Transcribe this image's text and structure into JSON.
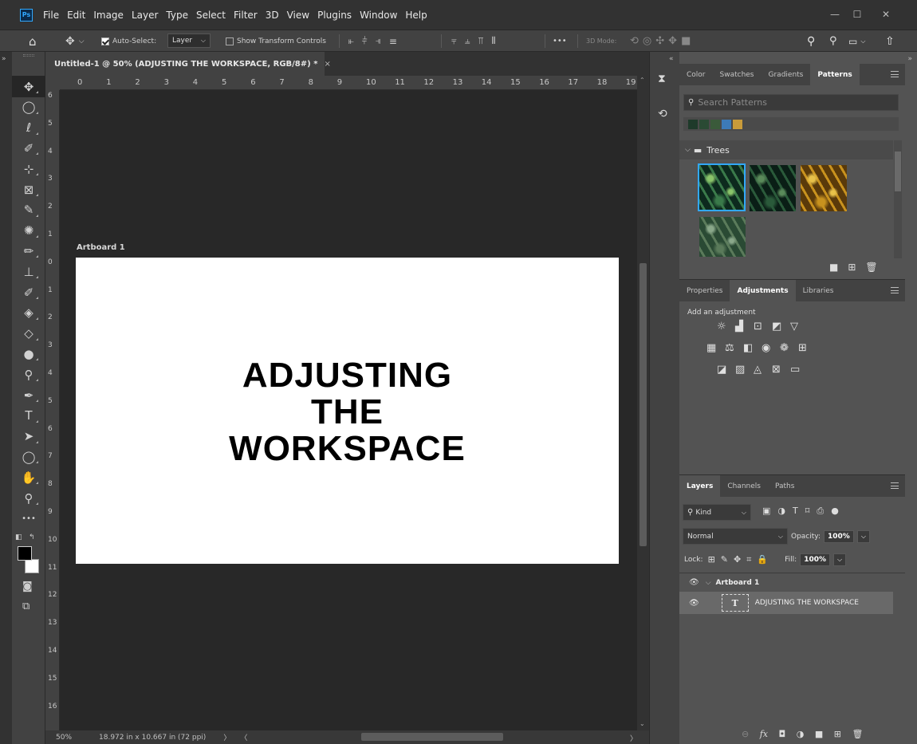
{
  "app": {
    "logo": "Ps"
  },
  "menubar": {
    "items": [
      "File",
      "Edit",
      "Image",
      "Layer",
      "Type",
      "Select",
      "Filter",
      "3D",
      "View",
      "Plugins",
      "Window",
      "Help"
    ]
  },
  "window_controls": {
    "minimize": "—",
    "maximize": "☐",
    "close": "✕"
  },
  "options_bar": {
    "home_icon": "home-icon",
    "auto_select_label": "Auto-Select:",
    "auto_select_checked": true,
    "auto_select_target": "Layer",
    "show_transform_label": "Show Transform Controls",
    "show_transform_checked": false,
    "more_label": "•••",
    "mode_3d_label": "3D Mode:"
  },
  "document": {
    "tab_title": "Untitled-1 @ 50% (ADJUSTING THE WORKSPACE, RGB/8#) *",
    "tab_close": "×",
    "artboard_label": "Artboard 1",
    "artboard_text_lines": [
      "ADJUSTING",
      "THE",
      "WORKSPACE"
    ],
    "zoom": "50%",
    "doc_info": "18.972 in x 10.667 in (72 ppi)",
    "status_arrow": "〉",
    "hscroll_left": "〈",
    "hscroll_right": "〉"
  },
  "rulers": {
    "horizontal": [
      "0",
      "1",
      "2",
      "3",
      "4",
      "5",
      "6",
      "7",
      "8",
      "9",
      "10",
      "11",
      "12",
      "13",
      "14",
      "15",
      "16",
      "17",
      "18",
      "19"
    ],
    "vertical": [
      "6",
      "5",
      "4",
      "3",
      "2",
      "1",
      "0",
      "1",
      "2",
      "3",
      "4",
      "5",
      "6",
      "7",
      "8",
      "9",
      "10",
      "11",
      "12",
      "13",
      "14",
      "15",
      "16"
    ]
  },
  "toolbar": {
    "tools": [
      {
        "name": "move-tool-icon",
        "glyph": "✥"
      },
      {
        "name": "elliptical-marquee-icon",
        "glyph": "◯"
      },
      {
        "name": "lasso-icon",
        "glyph": "ℓ"
      },
      {
        "name": "quick-selection-icon",
        "glyph": "✐"
      },
      {
        "name": "crop-icon",
        "glyph": "⊹"
      },
      {
        "name": "frame-icon",
        "glyph": "⊠"
      },
      {
        "name": "eyedropper-icon",
        "glyph": "✎"
      },
      {
        "name": "spot-healing-icon",
        "glyph": "✺"
      },
      {
        "name": "brush-icon",
        "glyph": "✏"
      },
      {
        "name": "clone-stamp-icon",
        "glyph": "⊥"
      },
      {
        "name": "history-brush-icon",
        "glyph": "✐"
      },
      {
        "name": "eraser-icon",
        "glyph": "◈"
      },
      {
        "name": "paint-bucket-icon",
        "glyph": "◇"
      },
      {
        "name": "blur-icon",
        "glyph": "●"
      },
      {
        "name": "dodge-icon",
        "glyph": "⚲"
      },
      {
        "name": "pen-icon",
        "glyph": "✒"
      },
      {
        "name": "type-icon",
        "glyph": "T"
      },
      {
        "name": "path-selection-icon",
        "glyph": "➤"
      },
      {
        "name": "ellipse-shape-icon",
        "glyph": "◯"
      },
      {
        "name": "hand-icon",
        "glyph": "✋"
      },
      {
        "name": "zoom-icon",
        "glyph": "⚲"
      },
      {
        "name": "edit-toolbar-icon",
        "glyph": "•••"
      }
    ],
    "quick_mask_icon": "quick-mask-icon",
    "screen_mode_icon": "screen-mode-icon"
  },
  "colors": {
    "foreground": "#000000",
    "background": "#ffffff",
    "accent": "#31a8ff",
    "panel": "#535353",
    "canvas_bg": "#282828"
  },
  "patterns_panel": {
    "tabs": [
      "Color",
      "Swatches",
      "Gradients",
      "Patterns"
    ],
    "active_tab": "Patterns",
    "search_placeholder": "Search Patterns",
    "recent_swatches": [
      "#1e3a2a",
      "#2a4a34",
      "#3a5a3a",
      "#3d7ab8",
      "#c99b3a"
    ],
    "group_name": "Trees",
    "group_icon": "folder-icon",
    "thumbnails": [
      {
        "name": "green-leaves",
        "colors": [
          "#0d2a1e",
          "#3a7a4a",
          "#8ac46a"
        ],
        "selected": true
      },
      {
        "name": "dark-leaves",
        "colors": [
          "#0a1e16",
          "#2a5a3a",
          "#5a8a5a"
        ],
        "selected": false
      },
      {
        "name": "autumn-leaves",
        "colors": [
          "#5a3a0a",
          "#c8921e",
          "#e8c24a"
        ],
        "selected": false
      },
      {
        "name": "grass",
        "colors": [
          "#2a4a34",
          "#5a7a5a",
          "#8aa88a"
        ],
        "selected": false
      }
    ]
  },
  "adjustments_panel": {
    "tabs": [
      "Properties",
      "Adjustments",
      "Libraries"
    ],
    "active_tab": "Adjustments",
    "heading": "Add an adjustment",
    "rows": [
      [
        "brightness-contrast-icon",
        "levels-icon",
        "curves-icon",
        "exposure-icon",
        "vibrance-icon"
      ],
      [
        "hue-saturation-icon",
        "color-balance-icon",
        "black-white-icon",
        "photo-filter-icon",
        "channel-mixer-icon",
        "color-lookup-icon"
      ],
      [
        "invert-icon",
        "posterize-icon",
        "threshold-icon",
        "selective-color-icon",
        "gradient-map-icon"
      ]
    ]
  },
  "layers_panel": {
    "tabs": [
      "Layers",
      "Channels",
      "Paths"
    ],
    "active_tab": "Layers",
    "filter_label": "Kind",
    "blend_mode": "Normal",
    "opacity_label": "Opacity:",
    "opacity_value": "100%",
    "lock_label": "Lock:",
    "fill_label": "Fill:",
    "fill_value": "100%",
    "layers": [
      {
        "name": "Artboard 1",
        "type": "artboard",
        "visible": true
      },
      {
        "name": "ADJUSTING THE WORKSPACE",
        "type": "text",
        "visible": true,
        "thumb": "T"
      }
    ],
    "footer_icons": [
      "link-layers-icon",
      "fx-icon",
      "add-mask-icon",
      "adjustment-layer-icon",
      "new-group-icon",
      "new-layer-icon",
      "delete-layer-icon"
    ],
    "fx_label": "fx"
  }
}
